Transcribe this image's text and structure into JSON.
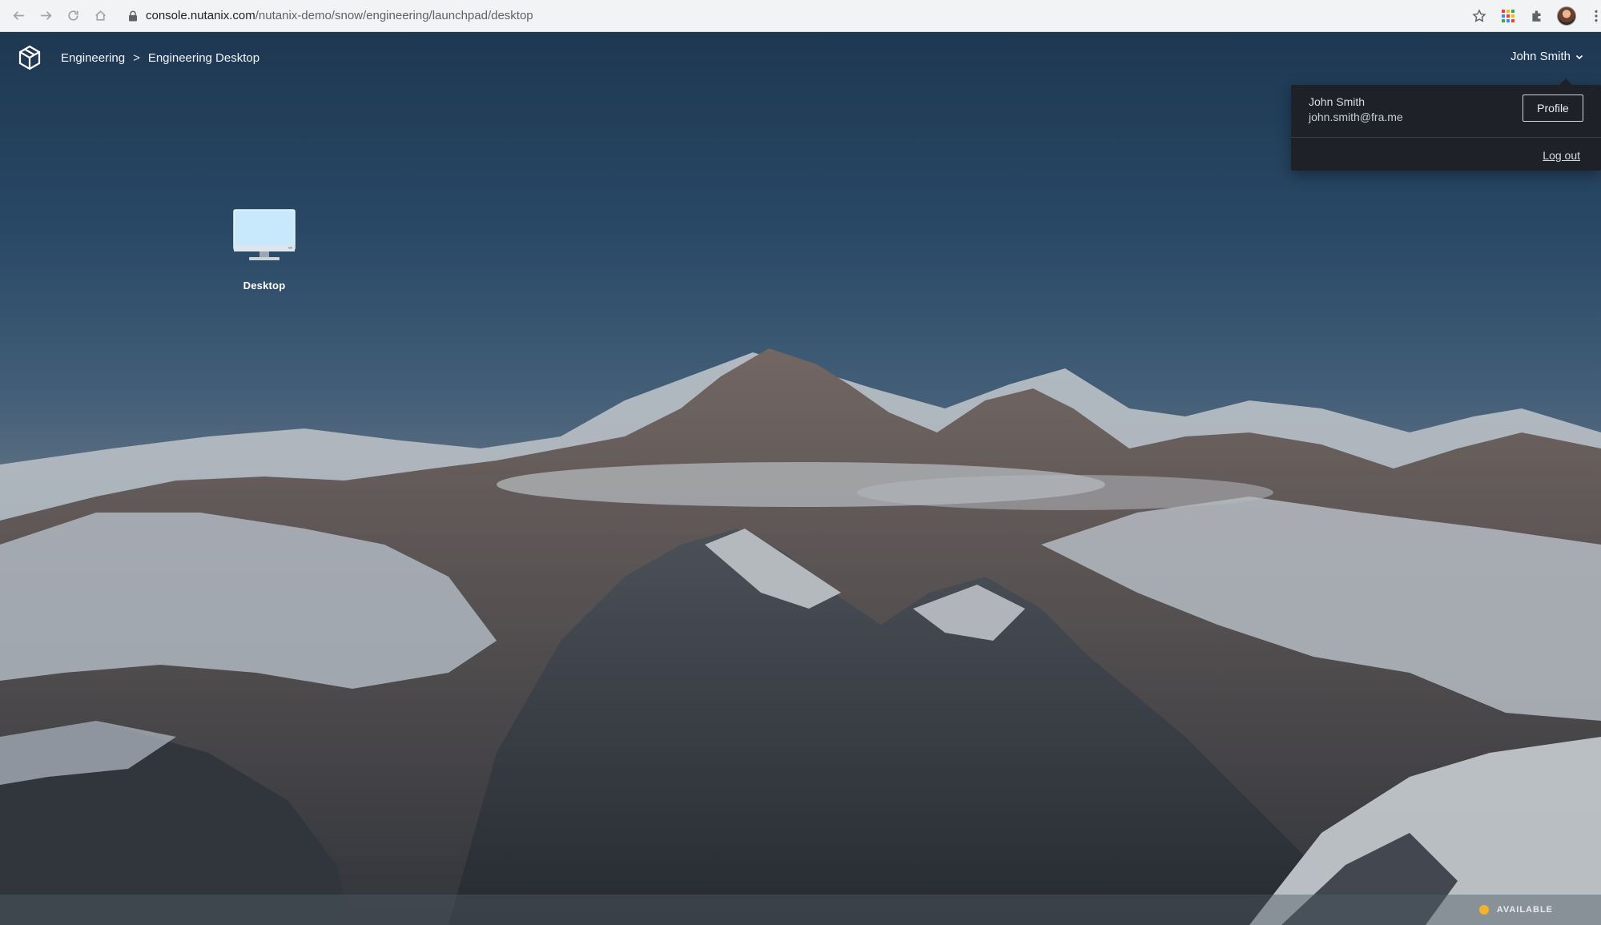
{
  "browser": {
    "url_host": "console.nutanix.com",
    "url_path": "/nutanix-demo/snow/engineering/launchpad/desktop",
    "icons": [
      "back-arrow-icon",
      "forward-arrow-icon",
      "reload-icon",
      "home-icon",
      "lock-icon",
      "star-icon",
      "apps-grid-icon",
      "extensions-icon",
      "avatar",
      "kebab-menu-icon"
    ]
  },
  "header": {
    "logo_icon": "nutanix-cube-icon",
    "breadcrumb": [
      "Engineering",
      "Engineering Desktop"
    ],
    "separator": ">",
    "user_name": "John Smith"
  },
  "user_dropdown": {
    "name": "John Smith",
    "email": "john.smith@fra.me",
    "profile_label": "Profile",
    "logout_label": "Log out"
  },
  "desktop": {
    "icon": "monitor-icon",
    "label": "Desktop"
  },
  "status": {
    "text": "AVAILABLE",
    "color": "#f0b429"
  }
}
